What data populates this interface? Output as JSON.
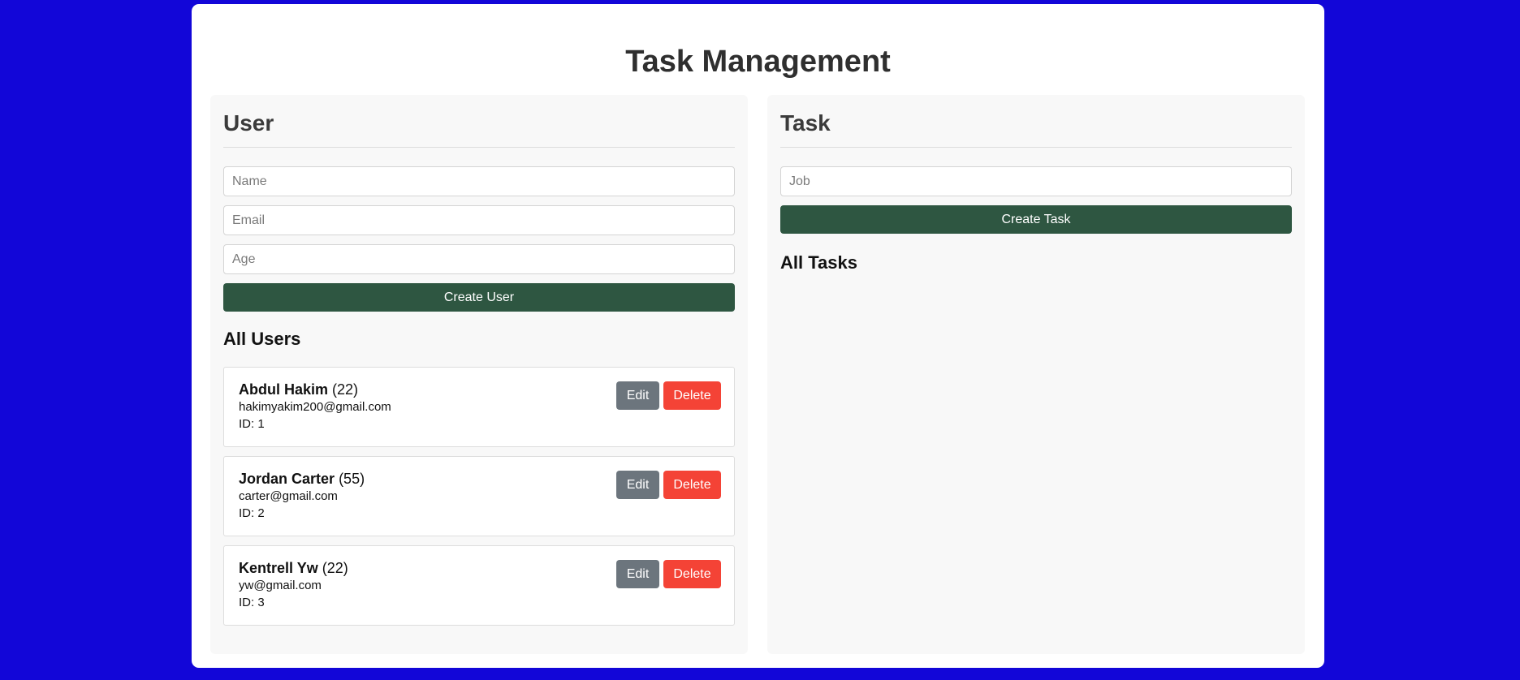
{
  "page": {
    "title": "Task Management",
    "background": "#1206d8"
  },
  "user_panel": {
    "heading": "User",
    "name_placeholder": "Name",
    "email_placeholder": "Email",
    "age_placeholder": "Age",
    "create_label": "Create User",
    "list_title": "All Users",
    "edit_label": "Edit",
    "delete_label": "Delete",
    "users": [
      {
        "name": "Abdul Hakim",
        "age": "(22)",
        "email": "hakimyakim200@gmail.com",
        "id": "ID: 1"
      },
      {
        "name": "Jordan Carter",
        "age": "(55)",
        "email": "carter@gmail.com",
        "id": "ID: 2"
      },
      {
        "name": "Kentrell Yw",
        "age": "(22)",
        "email": "yw@gmail.com",
        "id": "ID: 3"
      }
    ]
  },
  "task_panel": {
    "heading": "Task",
    "job_placeholder": "Job",
    "create_label": "Create Task",
    "list_title": "All Tasks"
  },
  "colors": {
    "primary": "#2e5641",
    "edit": "#6c757d",
    "delete": "#f44336"
  }
}
